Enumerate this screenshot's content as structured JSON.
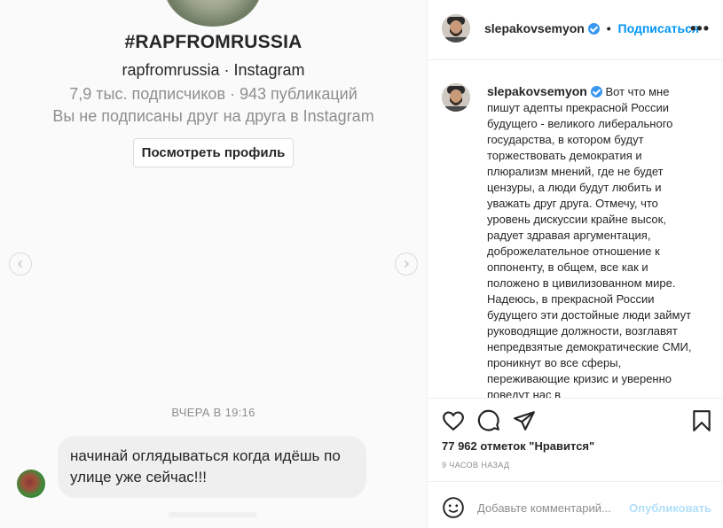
{
  "message_card": {
    "hashtag": "#RAPFROMRUSSIA",
    "handle": "rapfromrussia · Instagram",
    "stats": "7,9 тыс. подписчиков · 943 публикаций",
    "follow_status": "Вы не подписаны друг на друга в Instagram",
    "view_profile_label": "Посмотреть профиль"
  },
  "chat": {
    "timestamp": "ВЧЕРА В 19:16",
    "message": "начинай оглядываться когда идёшь по улице уже сейчас!!!"
  },
  "post": {
    "username": "slepakovsemyon",
    "separator": "•",
    "follow_label": "Подписаться",
    "more_label": "•••",
    "caption_user": "slepakovsemyon",
    "caption_text": "Вот что мне пишут адепты прекрасной России будущего - великого либерального государства, в котором будут торжествовать демократия и плюрализм мнений, где не будет цензуры, а люди будут любить и уважать друг друга. Отмечу, что уровень дискуссии крайне высок, радует здравая аргументация, доброжелательное отношение к оппоненту, в общем, все как и положено в цивилизованном мире. Надеюсь, в прекрасной России будущего эти достойные люди займут руководящие должности, возглавят непредвзятые демократические СМИ, проникнут во все сферы, переживающие кризис и уверенно поведут нас в",
    "likes": "77 962 отметок \"Нравится\"",
    "time_ago": "9 ЧАСОВ НАЗАД",
    "comment_placeholder": "Добавьте комментарий...",
    "publish_label": "Опубликовать"
  },
  "colors": {
    "accent": "#0095f6",
    "verified": "#3897f0",
    "muted": "#8e8e8e",
    "bubble": "#efefef"
  },
  "icons": [
    "chevron-left-icon",
    "chevron-right-icon",
    "verified-badge-icon",
    "heart-icon",
    "comment-icon",
    "share-icon",
    "bookmark-icon",
    "emoji-icon"
  ]
}
